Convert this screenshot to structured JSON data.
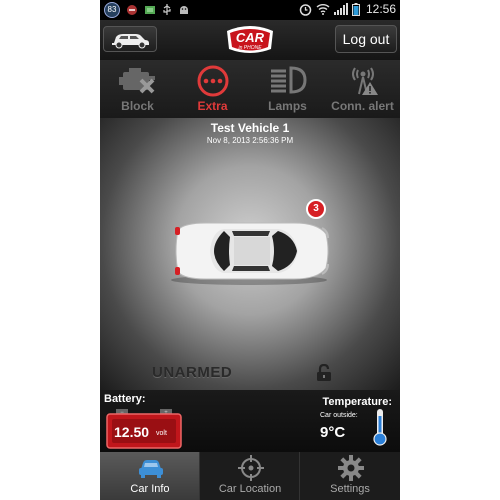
{
  "status_bar": {
    "badge_number": "83",
    "time": "12:56"
  },
  "header": {
    "logo_text_main": "CAR",
    "logo_text_sub": "in PHONE",
    "logout_label": "Log out"
  },
  "actions": [
    {
      "label": "Block",
      "icon": "engine-block-icon",
      "active": false
    },
    {
      "label": "Extra",
      "icon": "more-dots-icon",
      "active": true
    },
    {
      "label": "Lamps",
      "icon": "headlamp-icon",
      "active": false
    },
    {
      "label": "Conn. alert",
      "icon": "signal-alert-icon",
      "active": false
    }
  ],
  "vehicle": {
    "name": "Test Vehicle 1",
    "timestamp": "Nov 8, 2013 2:56:36 PM",
    "notification_count": "3",
    "arm_state": "UNARMED"
  },
  "battery": {
    "label": "Battery:",
    "value": "12.50",
    "unit": "volt"
  },
  "temperature": {
    "label": "Temperature:",
    "sub_label": "Car outside:",
    "value": "9°C"
  },
  "nav": [
    {
      "label": "Car Info",
      "icon": "car-icon",
      "active": true
    },
    {
      "label": "Car Location",
      "icon": "crosshair-icon",
      "active": false
    },
    {
      "label": "Settings",
      "icon": "gear-icon",
      "active": false
    }
  ],
  "colors": {
    "accent_red": "#e03a3a",
    "badge_red": "#d61f24",
    "battery_red": "#c0161b"
  }
}
